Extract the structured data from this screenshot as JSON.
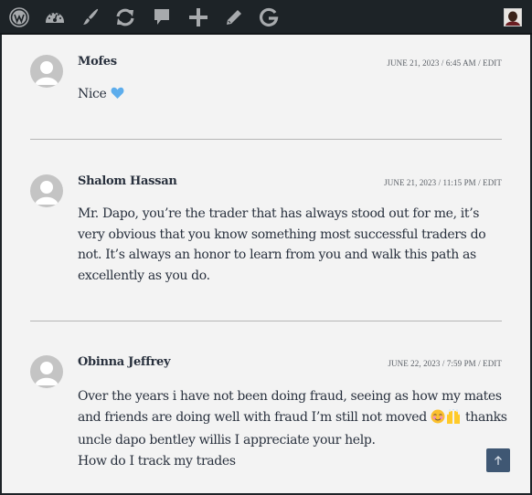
{
  "adminbar": {
    "icons": [
      {
        "name": "wordpress-logo-icon"
      },
      {
        "name": "dashboard-icon"
      },
      {
        "name": "customize-brush-icon"
      },
      {
        "name": "updates-icon"
      },
      {
        "name": "comments-icon"
      },
      {
        "name": "new-content-icon"
      },
      {
        "name": "edit-icon"
      },
      {
        "name": "google-icon"
      }
    ],
    "colors": {
      "background": "#1d2327",
      "icon": "#a7aaad"
    }
  },
  "comments": [
    {
      "author": "Mofes",
      "date": "June 21, 2023",
      "time": "6:45 am",
      "edit_label": "Edit",
      "body": [
        "Nice"
      ],
      "emoji": "blue-heart"
    },
    {
      "author": "Shalom Hassan",
      "date": "June 21, 2023",
      "time": "11:15 pm",
      "edit_label": "Edit",
      "body": [
        "Mr. Dapo, you’re the trader that has always stood out for me, it’s very obvious that you know something most successful traders do not. It’s always an honor to learn from you and walk this path as excellently as you do."
      ]
    },
    {
      "author": "Obinna Jeffrey",
      "date": "June 22, 2023",
      "time": "7:59 pm",
      "edit_label": "Edit",
      "body_line1_before_emoji": "Over the years i have not been doing fraud, seeing as how my mates and friends are doing well with fraud I’m still not moved",
      "body_line1_after_emoji": " thanks uncle dapo bentley willis I appreciate your help.",
      "body_line2": "How do I track my trades",
      "emojis": [
        "smiling-face-icon",
        "raising-hands-icon"
      ]
    }
  ],
  "meta_separator": " / ",
  "scroll_to_top": {
    "label": "↑",
    "color": "#3f5773"
  },
  "accent_color": "#28303d"
}
